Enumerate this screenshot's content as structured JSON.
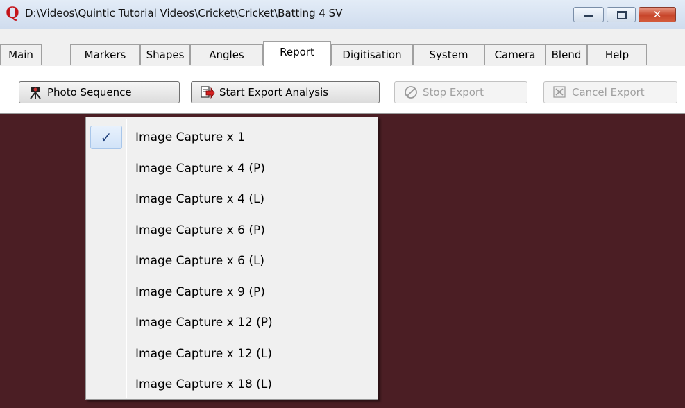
{
  "window": {
    "title": "D:\\Videos\\Quintic Tutorial Videos\\Cricket\\Cricket\\Batting 4 SV",
    "app_icon_letter": "Q",
    "close_glyph": "✕"
  },
  "tabs": [
    {
      "label": "Main"
    },
    {
      "label": "Markers"
    },
    {
      "label": "Shapes"
    },
    {
      "label": "Angles"
    },
    {
      "label": "Report",
      "active": true
    },
    {
      "label": "Digitisation"
    },
    {
      "label": "System"
    },
    {
      "label": "Camera"
    },
    {
      "label": "Blend"
    },
    {
      "label": "Help"
    }
  ],
  "toolbar": {
    "photo_sequence": "Photo Sequence",
    "start_export": "Start Export Analysis",
    "stop_export": "Stop Export",
    "cancel_export": "Cancel Export"
  },
  "menu": {
    "check_glyph": "✓",
    "items": [
      {
        "label": "Image Capture x 1",
        "checked": true
      },
      {
        "label": "Image Capture x 4 (P)"
      },
      {
        "label": "Image Capture x 4 (L)"
      },
      {
        "label": "Image Capture x 6 (P)"
      },
      {
        "label": "Image Capture x 6 (L)"
      },
      {
        "label": "Image Capture x 9 (P)"
      },
      {
        "label": "Image Capture x 12 (P)"
      },
      {
        "label": "Image Capture x 12 (L)"
      },
      {
        "label": "Image Capture x 18 (L)"
      }
    ]
  },
  "colors": {
    "stage_background": "#4b1e24",
    "app_icon": "#c4141a",
    "check_highlight": "#d1e3f8"
  }
}
